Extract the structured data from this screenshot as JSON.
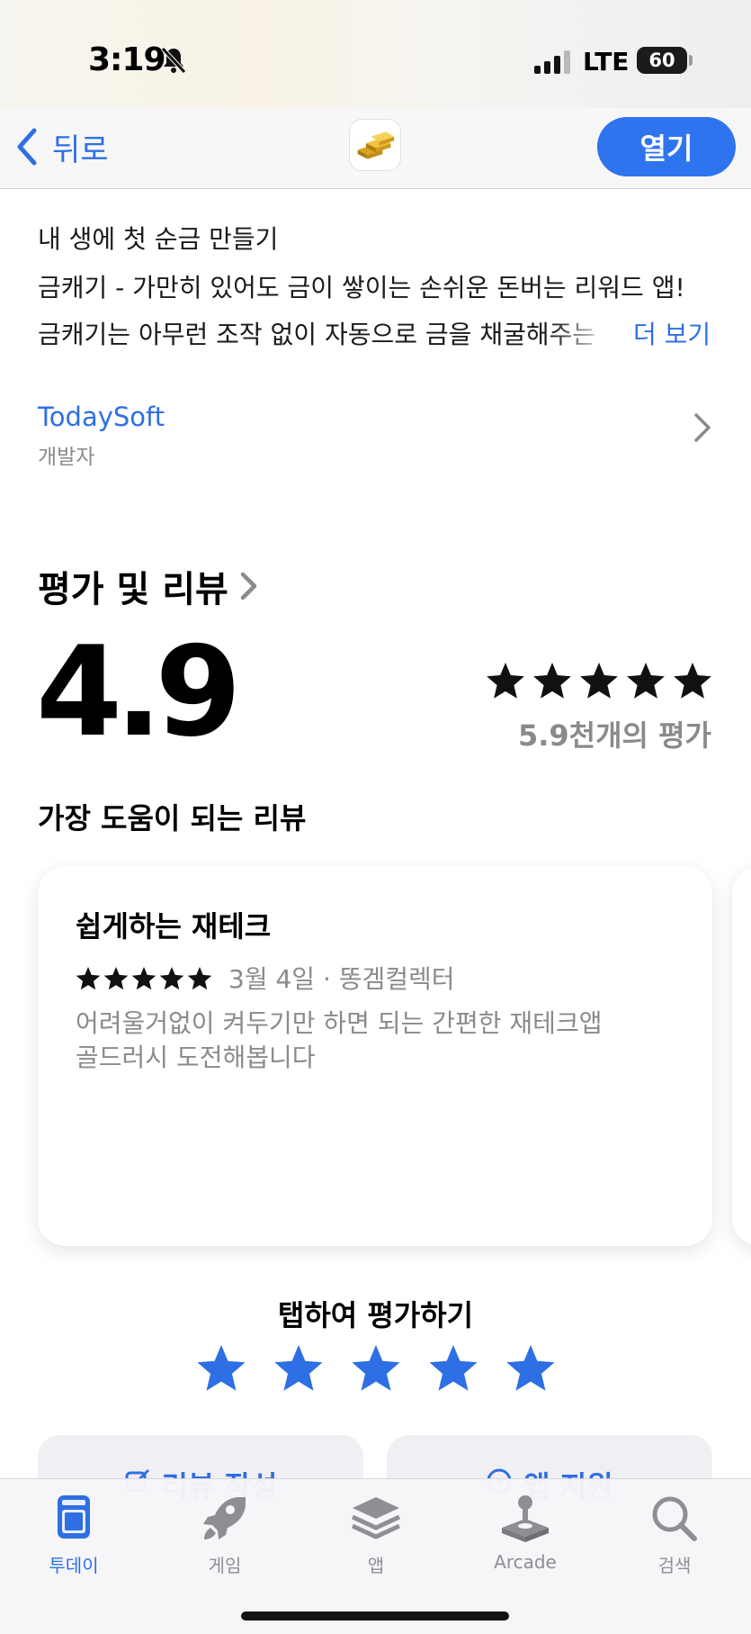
{
  "status_bar": {
    "time": "3:19",
    "network": "LTE",
    "battery": "60",
    "icons": [
      "bell-slash-icon",
      "signal-icon",
      "battery-icon"
    ]
  },
  "nav": {
    "back_label": "뒤로",
    "open_label": "열기",
    "app_icon": "gold-bars-icon"
  },
  "description": {
    "line1": "내 생에 첫 순금 만들기",
    "line2": "금캐기 - 가만히 있어도 금이 쌓이는 손쉬운 돈버는 리워드 앱!",
    "line3": "금캐기는 아무런 조작 없이 자동으로 금을 채굴해주는",
    "more": "더 보기"
  },
  "developer": {
    "name": "TodaySoft",
    "label": "개발자"
  },
  "ratings": {
    "title": "평가 및 리뷰",
    "score": "4.9",
    "stars": 4.9,
    "count": "5.9천개의 평가"
  },
  "helpful": {
    "title": "가장 도움이 되는 리뷰",
    "review": {
      "title": "쉽게하는 재테크",
      "stars": 5,
      "meta": "3월 4일 · 똥겜컬렉터",
      "body_line1": "어려울거없이 켜두기만 하면 되는 간편한 재테크앱",
      "body_line2": "골드러시 도전해봅니다"
    }
  },
  "tap_to_rate": {
    "title": "탭하여 평가하기"
  },
  "actions": {
    "write_review": "리뷰 작성",
    "app_support": "앱 지원"
  },
  "tabs": [
    {
      "label": "투데이",
      "icon": "today-icon",
      "active": true
    },
    {
      "label": "게임",
      "icon": "rocket-icon",
      "active": false
    },
    {
      "label": "앱",
      "icon": "layers-icon",
      "active": false
    },
    {
      "label": "Arcade",
      "icon": "joystick-icon",
      "active": false
    },
    {
      "label": "검색",
      "icon": "search-icon",
      "active": false
    }
  ],
  "colors": {
    "accent": "#2f6fe4",
    "secondary_text": "#8a8a8e"
  }
}
